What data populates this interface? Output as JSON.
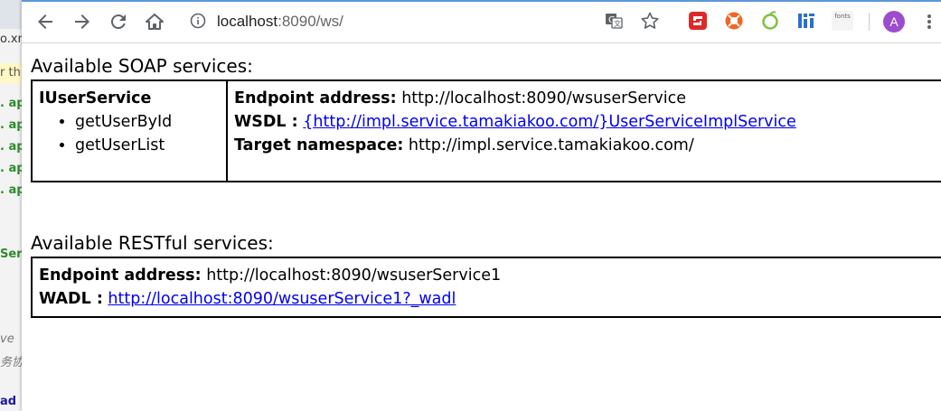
{
  "background_window": {
    "fragments": [
      "o.xn",
      "r th",
      ". ap",
      ". ap",
      ". ap",
      ". ap",
      ". ap",
      "Ser",
      "ve",
      "务协",
      "ad"
    ]
  },
  "browser": {
    "url_host": "localhost",
    "url_rest": ":8090/ws/",
    "avatar_letter": "A",
    "ext_fonts_label": "fonts"
  },
  "soap": {
    "heading": "Available SOAP services:",
    "service_name": "IUserService",
    "operations": [
      "getUserById",
      "getUserList"
    ],
    "endpoint_label": "Endpoint address:",
    "endpoint_value": "http://localhost:8090/wsuserService",
    "wsdl_label": "WSDL :",
    "wsdl_link": "{http://impl.service.tamakiakoo.com/}UserServiceImplService",
    "ns_label": "Target namespace:",
    "ns_value": "http://impl.service.tamakiakoo.com/"
  },
  "rest": {
    "heading": "Available RESTful services:",
    "endpoint_label": "Endpoint address:",
    "endpoint_value": "http://localhost:8090/wsuserService1",
    "wadl_label": "WADL :",
    "wadl_link": "http://localhost:8090/wsuserService1?_wadl"
  }
}
